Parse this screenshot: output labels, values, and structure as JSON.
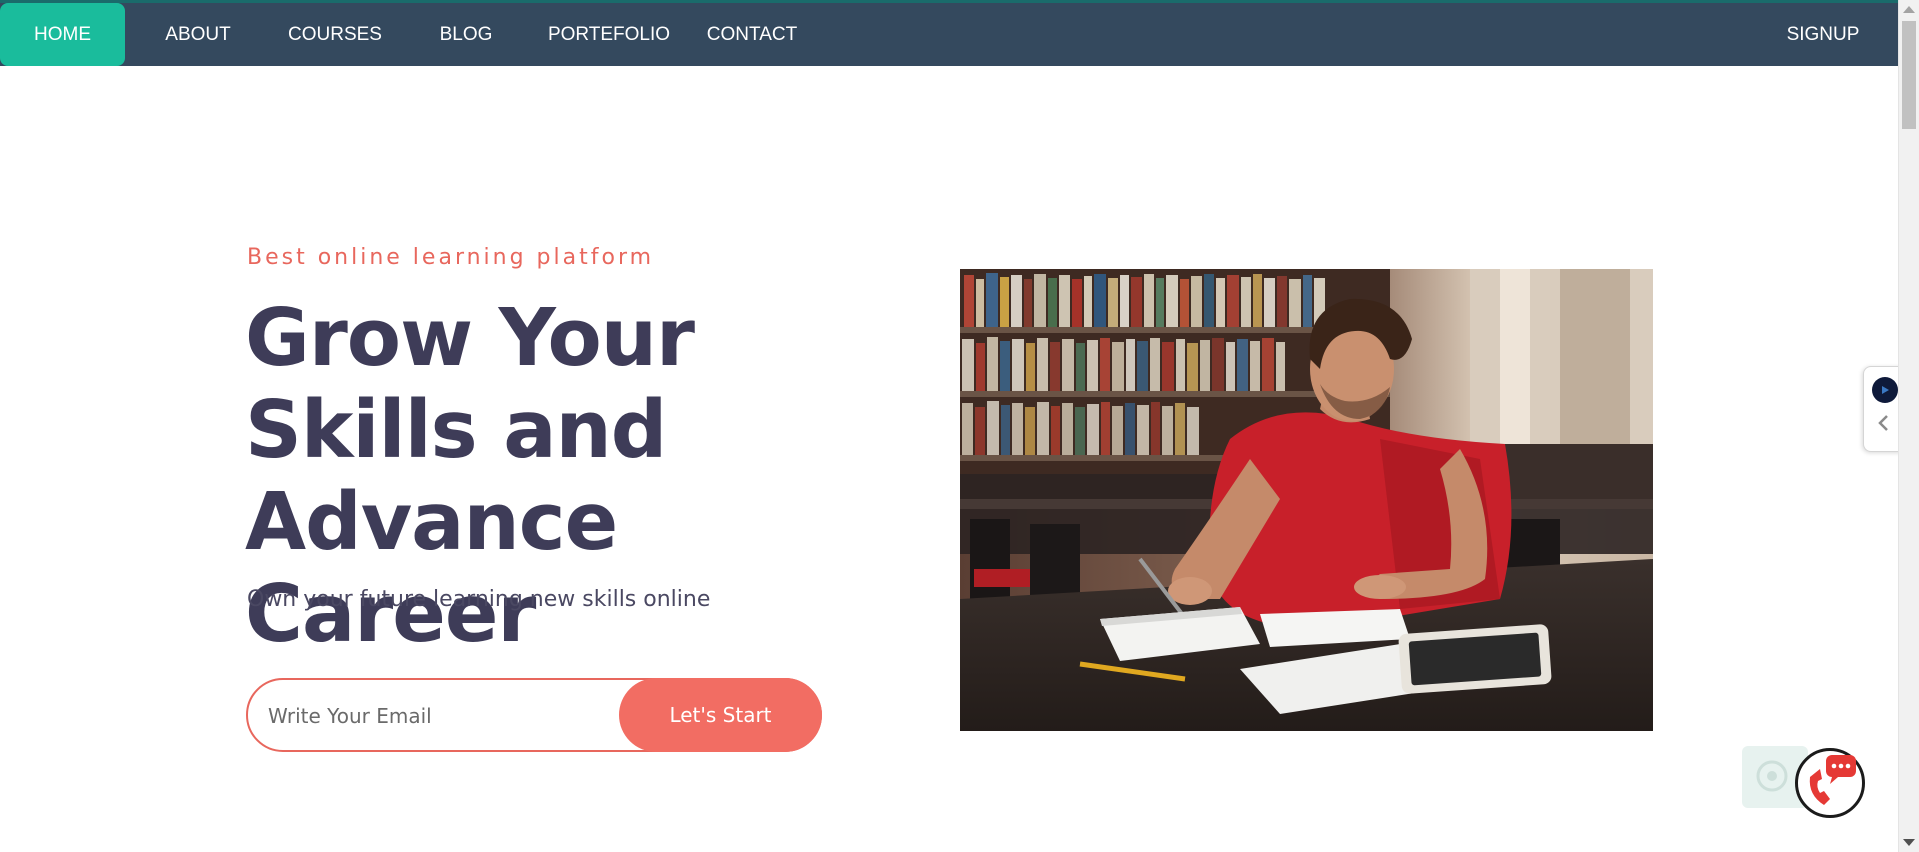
{
  "nav": {
    "items": [
      {
        "label": "HOME",
        "active": true
      },
      {
        "label": "ABOUT",
        "active": false
      },
      {
        "label": "COURSES",
        "active": false
      },
      {
        "label": "BLOG",
        "active": false
      },
      {
        "label": "PORTEFOLIO",
        "active": false
      },
      {
        "label": "CONTACT",
        "active": false
      }
    ],
    "signup_label": "SIGNUP"
  },
  "hero": {
    "tagline": "Best online learning platform",
    "headline": "Grow Your Skills and Advance Career",
    "subtext": "Own your future learning new skills online",
    "email_placeholder": "Write Your Email",
    "cta_label": "Let's Start",
    "image_alt": "student studying in library"
  },
  "colors": {
    "nav_bg": "#34495e",
    "nav_active": "#1abc9c",
    "accent": "#f26d63",
    "headline": "#3e3c58"
  },
  "icons": {
    "side_widget": [
      "audio-icon",
      "chevron-left-icon"
    ],
    "chat": "chat-phone-icon"
  }
}
